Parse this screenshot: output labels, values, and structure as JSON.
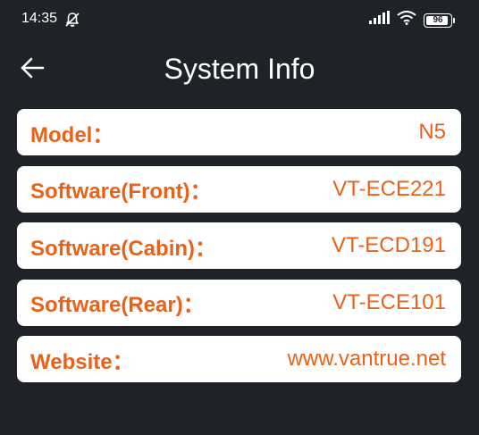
{
  "status_bar": {
    "time": "14:35",
    "battery": "96",
    "battery_level_percent": 96,
    "icons": [
      "bell-off-icon",
      "signal-icon",
      "wifi-icon",
      "battery-icon"
    ]
  },
  "header": {
    "title": "System Info",
    "back_icon": "arrow-left-icon"
  },
  "info_rows": [
    {
      "label": "Model：",
      "value": "N5"
    },
    {
      "label": "Software(Front)：",
      "value": "VT-ECE221"
    },
    {
      "label": "Software(Cabin)：",
      "value": "VT-ECD191"
    },
    {
      "label": "Software(Rear)：",
      "value": "VT-ECE101"
    },
    {
      "label": "Website：",
      "value": "www.vantrue.net"
    }
  ],
  "colors": {
    "background": "#1f2228",
    "card": "#ffffff",
    "accent": "#e8621a",
    "text_light": "#ffffff"
  }
}
